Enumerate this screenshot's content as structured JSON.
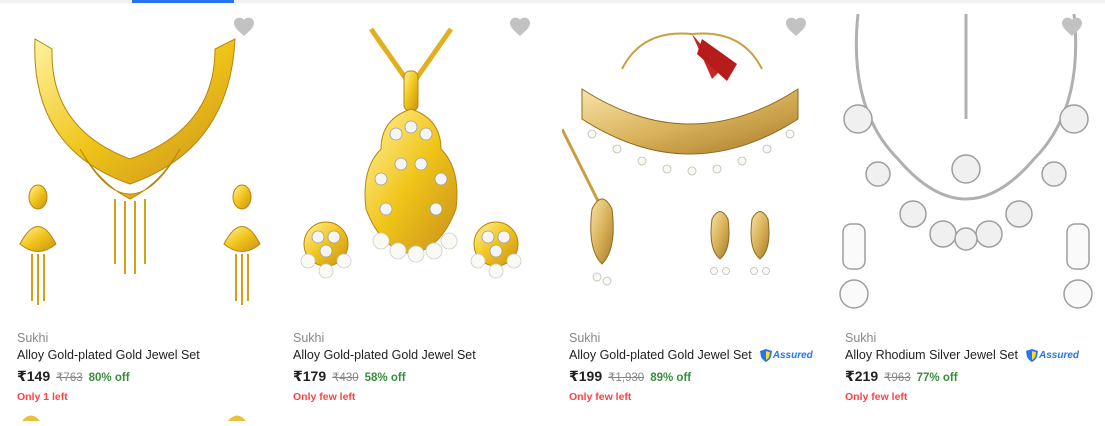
{
  "tab_indicator_color": "#2874f0",
  "colors": {
    "price_discount": "#388e3c",
    "stock_warning": "#ff4343",
    "muted": "#878787",
    "assured": "#2874f0"
  },
  "products": [
    {
      "brand": "Sukhi",
      "title": "Alloy Gold-plated Gold Jewel Set",
      "price": "₹149",
      "mrp": "₹763",
      "discount": "80% off",
      "stock": "Only 1 left",
      "assured": false,
      "assured_label": "",
      "image_icon": "gold-necklace-set-image",
      "wishlist_icon": "heart-icon"
    },
    {
      "brand": "Sukhi",
      "title": "Alloy Gold-plated Gold Jewel Set",
      "price": "₹179",
      "mrp": "₹430",
      "discount": "58% off",
      "stock": "Only few left",
      "assured": false,
      "assured_label": "",
      "image_icon": "gold-pendant-set-image",
      "wishlist_icon": "heart-icon"
    },
    {
      "brand": "Sukhi",
      "title": "Alloy Gold-plated Gold Jewel Set",
      "price": "₹199",
      "mrp": "₹1,930",
      "discount": "89% off",
      "stock": "Only few left",
      "assured": true,
      "assured_label": "Assured",
      "image_icon": "gold-choker-set-image",
      "wishlist_icon": "heart-icon"
    },
    {
      "brand": "Sukhi",
      "title": "Alloy Rhodium Silver Jewel Set",
      "price": "₹219",
      "mrp": "₹963",
      "discount": "77% off",
      "stock": "Only few left",
      "assured": true,
      "assured_label": "Assured",
      "image_icon": "silver-necklace-set-image",
      "wishlist_icon": "heart-icon"
    }
  ]
}
